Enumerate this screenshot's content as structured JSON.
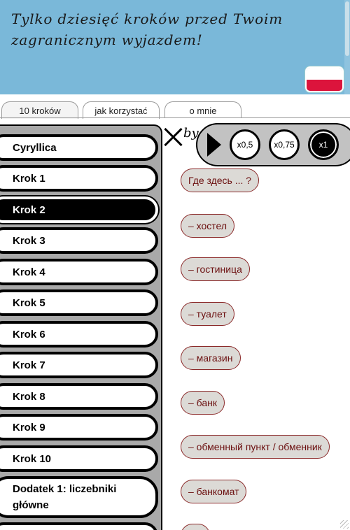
{
  "header": {
    "title": "Tylko dziesięć kroków przed Twoim zagranicznym wyjazdem!",
    "flag": "flag-poland-icon"
  },
  "tabs": [
    {
      "label": "10 kroków"
    },
    {
      "label": "jak korzystać"
    },
    {
      "label": "o mnie"
    }
  ],
  "content": {
    "peek_text": "by",
    "phrases": [
      "Где здесь ... ?",
      "– хостел",
      "– гостиница",
      "– туалет",
      "– магазин",
      "– банк",
      "– обменный пункт / обменник",
      "– банкомат",
      ""
    ]
  },
  "player": {
    "speeds": [
      "x0,5",
      "x0,75",
      "x1"
    ],
    "active_speed": "x1"
  },
  "sidebar": {
    "items": [
      {
        "label": "Cyryllica"
      },
      {
        "label": "Krok 1"
      },
      {
        "label": "Krok 2"
      },
      {
        "label": "Krok 3"
      },
      {
        "label": "Krok 4"
      },
      {
        "label": "Krok 5"
      },
      {
        "label": "Krok 6"
      },
      {
        "label": "Krok 7"
      },
      {
        "label": "Krok 8"
      },
      {
        "label": "Krok 9"
      },
      {
        "label": "Krok 10"
      },
      {
        "label": "Dodatek 1: liczebniki główne"
      },
      {
        "label": ""
      }
    ],
    "active_item": "Krok 2"
  },
  "colors": {
    "header_bg": "#7ab8d9",
    "phrase_bg": "#dcdad6",
    "phrase_text": "#6b0f0f",
    "sidebar_bg": "#a9a9a9"
  }
}
